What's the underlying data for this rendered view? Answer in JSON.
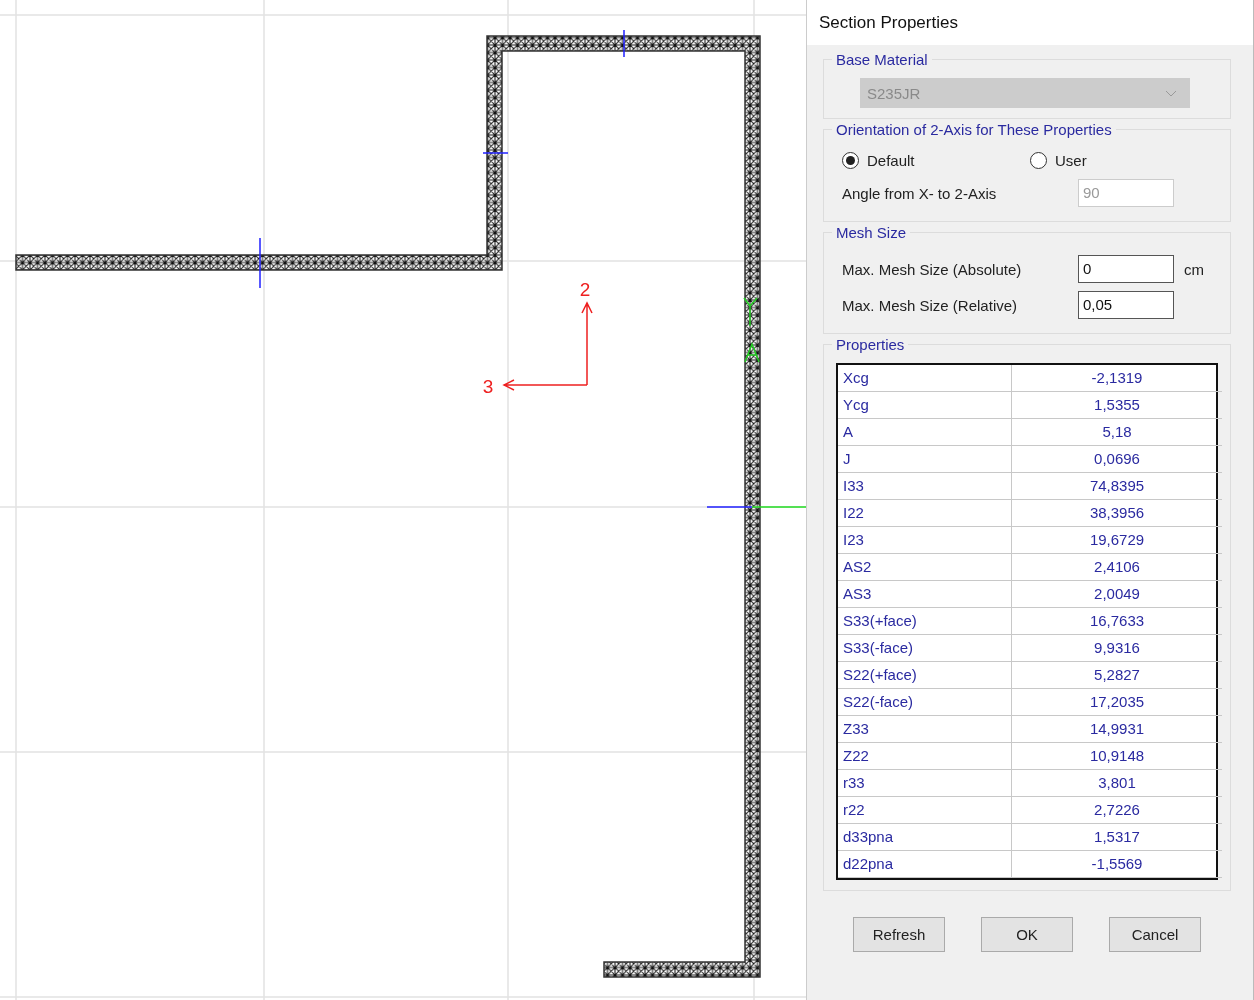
{
  "canvas": {
    "axis_labels": [
      {
        "kind": "up",
        "text": "2"
      },
      {
        "kind": "left",
        "text": "3"
      }
    ]
  },
  "dialog": {
    "title": "Section Properties",
    "base_material": {
      "legend": "Base Material",
      "value": "S235JR",
      "disabled": true
    },
    "orientation": {
      "legend": "Orientation of 2-Axis for These Properties",
      "options": [
        {
          "label": "Default",
          "selected": true
        },
        {
          "label": "User",
          "selected": false
        }
      ],
      "angle_label": "Angle from X- to 2-Axis",
      "angle_value": "90",
      "angle_disabled": true
    },
    "mesh_size": {
      "legend": "Mesh Size",
      "rows": [
        {
          "label": "Max. Mesh Size (Absolute)",
          "value": "0",
          "unit": "cm"
        },
        {
          "label": "Max. Mesh Size (Relative)",
          "value": "0,05"
        }
      ]
    },
    "properties": {
      "legend": "Properties",
      "rows": [
        {
          "name": "Xcg",
          "value": "-2,1319"
        },
        {
          "name": "Ycg",
          "value": "1,5355"
        },
        {
          "name": "A",
          "value": "5,18"
        },
        {
          "name": "J",
          "value": "0,0696"
        },
        {
          "name": "I33",
          "value": "74,8395"
        },
        {
          "name": "I22",
          "value": "38,3956"
        },
        {
          "name": "I23",
          "value": "19,6729"
        },
        {
          "name": "AS2",
          "value": "2,4106"
        },
        {
          "name": "AS3",
          "value": "2,0049"
        },
        {
          "name": "S33(+face)",
          "value": "16,7633"
        },
        {
          "name": "S33(-face)",
          "value": "9,9316"
        },
        {
          "name": "S22(+face)",
          "value": "5,2827"
        },
        {
          "name": "S22(-face)",
          "value": "17,2035"
        },
        {
          "name": "Z33",
          "value": "14,9931"
        },
        {
          "name": "Z22",
          "value": "10,9148"
        },
        {
          "name": "r33",
          "value": "3,801"
        },
        {
          "name": "r22",
          "value": "2,7226"
        },
        {
          "name": "d33pna",
          "value": "1,5317"
        },
        {
          "name": "d22pna",
          "value": "-1,5569"
        }
      ]
    },
    "buttons": [
      "Refresh",
      "OK",
      "Cancel"
    ]
  }
}
